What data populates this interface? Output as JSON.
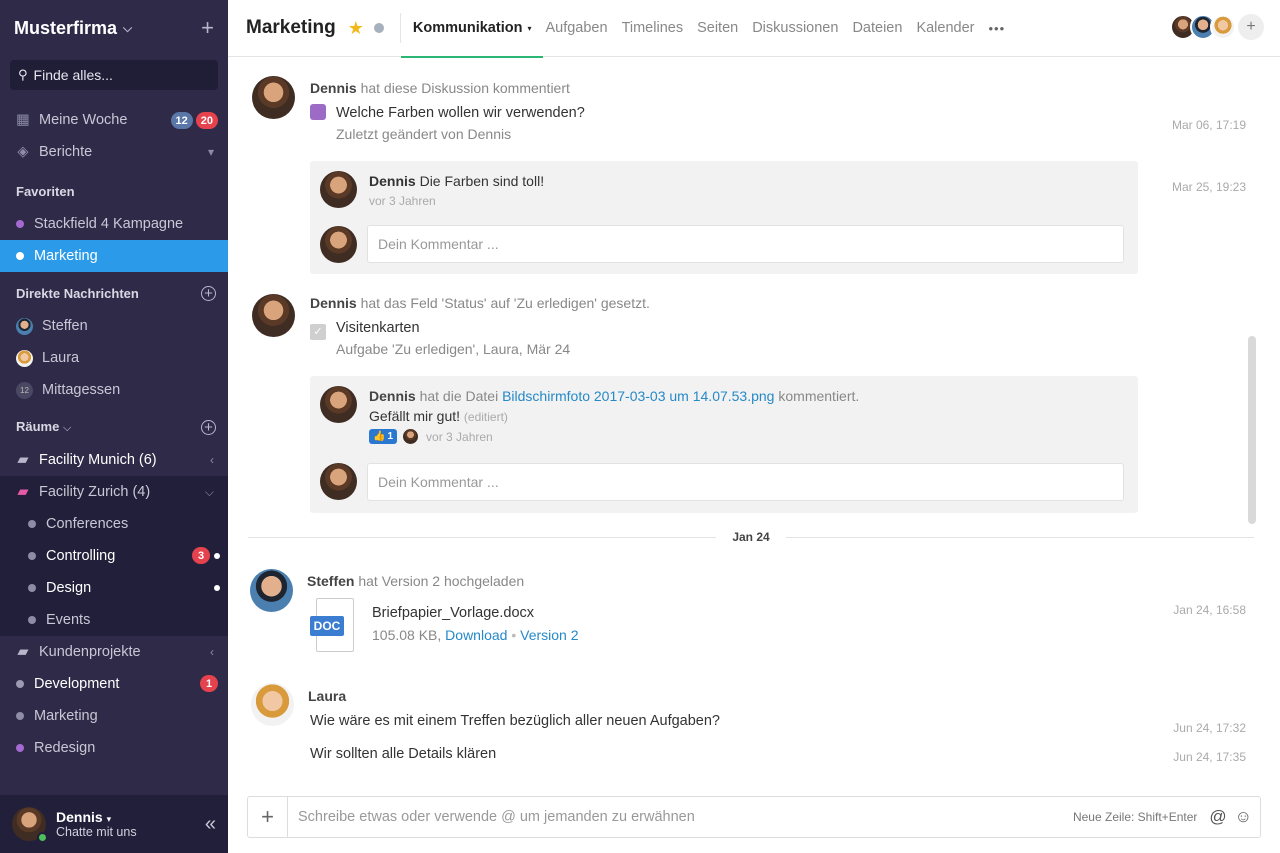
{
  "sidebar": {
    "company": "Musterfirma",
    "search_placeholder": "Finde alles...",
    "my_week": {
      "label": "Meine Woche",
      "badge_blue": "12",
      "badge_red": "20"
    },
    "reports": {
      "label": "Berichte"
    },
    "favorites_title": "Favoriten",
    "favorites": [
      {
        "label": "Stackfield 4 Kampagne",
        "color": "#a56ad2"
      },
      {
        "label": "Marketing",
        "color": "#ffffff"
      }
    ],
    "dm_title": "Direkte Nachrichten",
    "dms": [
      {
        "label": "Steffen"
      },
      {
        "label": "Laura"
      },
      {
        "label": "Mittagessen",
        "count": "12"
      }
    ],
    "rooms_title": "Räume",
    "rooms": [
      {
        "label": "Facility Munich (6)"
      },
      {
        "label": "Facility Zurich (4)"
      },
      {
        "label": "Conferences"
      },
      {
        "label": "Controlling",
        "badge": "3"
      },
      {
        "label": "Design"
      },
      {
        "label": "Events"
      },
      {
        "label": "Kundenprojekte"
      },
      {
        "label": "Development",
        "badge": "1"
      },
      {
        "label": "Marketing"
      },
      {
        "label": "Redesign"
      }
    ],
    "user": {
      "name": "Dennis",
      "status": "Chatte mit uns"
    }
  },
  "header": {
    "title": "Marketing",
    "tabs": [
      "Kommunikation",
      "Aufgaben",
      "Timelines",
      "Seiten",
      "Diskussionen",
      "Dateien",
      "Kalender"
    ],
    "more": "•••",
    "add": "+"
  },
  "feed": {
    "e1": {
      "author": "Dennis",
      "action": "hat diese Diskussion kommentiert",
      "title": "Welche Farben wollen wir verwenden?",
      "sub": "Zuletzt geändert von Dennis",
      "time": "Mar 06, 17:19",
      "comment": {
        "author": "Dennis",
        "text": "Die Farben sind toll!",
        "ago": "vor 3 Jahren",
        "time": "Mar 25, 19:23"
      },
      "input_placeholder": "Dein Kommentar ..."
    },
    "e2": {
      "author": "Dennis",
      "action": "hat das Feld 'Status' auf 'Zu erledigen' gesetzt.",
      "title": "Visitenkarten",
      "sub": "Aufgabe 'Zu erledigen', Laura, Mär 24",
      "comment": {
        "author": "Dennis",
        "pre": "hat die Datei",
        "file": "Bildschirmfoto 2017-03-03 um 14.07.53.png",
        "post": "kommentiert.",
        "text": "Gefällt mir gut!",
        "edited": "(editiert)",
        "likes": "1",
        "ago": "vor 3 Jahren"
      },
      "input_placeholder": "Dein Kommentar ..."
    },
    "day": "Jan 24",
    "e3": {
      "author": "Steffen",
      "action": "hat Version 2 hochgeladen",
      "file": "Briefpapier_Vorlage.docx",
      "size": "105.08 KB,",
      "download": "Download",
      "bullet": "•",
      "version": "Version 2",
      "doc_tag": "DOC",
      "time": "Jan 24, 16:58"
    },
    "e4": {
      "author": "Laura",
      "msg1": "Wie wäre es mit einem Treffen bezüglich aller neuen Aufgaben?",
      "time1": "Jun 24, 17:32",
      "msg2": "Wir sollten alle Details klären",
      "time2": "Jun 24, 17:35"
    }
  },
  "composer": {
    "placeholder": "Schreibe etwas oder verwende @ um jemanden zu erwähnen",
    "hint": "Neue Zeile: Shift+Enter",
    "at": "@",
    "plus": "+"
  },
  "colors": {
    "active": "#2b9ae8",
    "sidebar": "#2e2a48",
    "accent": "#2bb673",
    "link": "#2589c8"
  }
}
